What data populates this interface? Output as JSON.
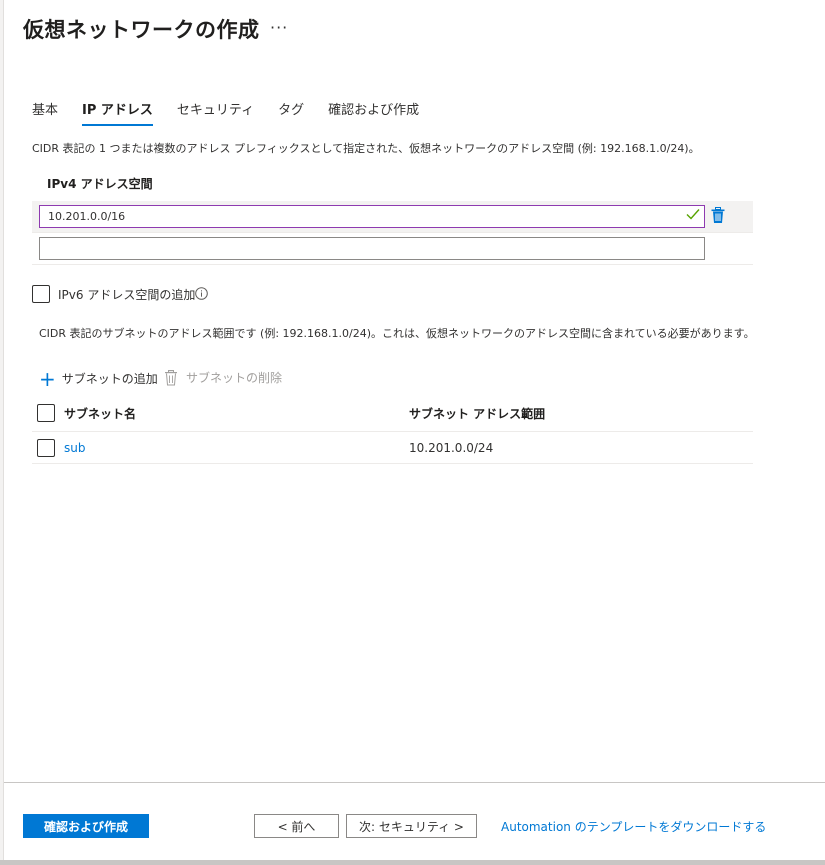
{
  "header": {
    "title": "仮想ネットワークの作成",
    "more": "···"
  },
  "tabs": [
    {
      "label": "基本",
      "active": false
    },
    {
      "label": "IP アドレス",
      "active": true
    },
    {
      "label": "セキュリティ",
      "active": false
    },
    {
      "label": "タグ",
      "active": false
    },
    {
      "label": "確認および作成",
      "active": false
    }
  ],
  "ipv4": {
    "description": "CIDR 表記の 1 つまたは複数のアドレス プレフィックスとして指定された、仮想ネットワークのアドレス空間 (例: 192.168.1.0/24)。",
    "label": "IPv4 アドレス空間",
    "address_value": "10.201.0.0/16",
    "empty_value": ""
  },
  "ipv6": {
    "checkbox_label": "IPv6 アドレス空間の追加",
    "checked": false
  },
  "subnets": {
    "description": "CIDR 表記のサブネットのアドレス範囲です (例: 192.168.1.0/24)。これは、仮想ネットワークのアドレス空間に含まれている必要があります。",
    "add_label": "サブネットの追加",
    "delete_label": "サブネットの削除",
    "columns": [
      "サブネット名",
      "サブネット アドレス範囲"
    ],
    "rows": [
      {
        "name": "sub",
        "range": "10.201.0.0/24"
      }
    ]
  },
  "footer": {
    "review_create": "確認および作成",
    "previous": "< 前へ",
    "next": "次: セキュリティ >",
    "download": "Automation のテンプレートをダウンロードする"
  },
  "colors": {
    "accent": "#0078d4",
    "focus_border": "#8e3ab0",
    "valid_check": "#57a300"
  }
}
